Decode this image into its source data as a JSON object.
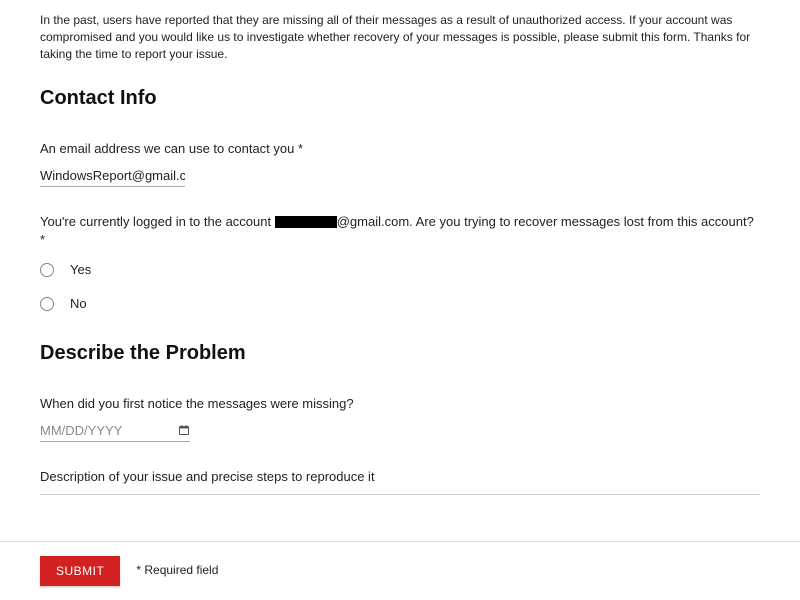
{
  "intro": "In the past, users have reported that they are missing all of their messages as a result of unauthorized access. If your account was compromised and you would like us to investigate whether recovery of your messages is possible, please submit this form. Thanks for taking the time to report your issue.",
  "sections": {
    "contact": {
      "heading": "Contact Info",
      "email_label": "An email address we can use to contact you *",
      "email_value": "WindowsReport@gmail.com",
      "logged_in_prefix": "You're currently logged in to the account ",
      "logged_in_domain": "@gmail.com",
      "logged_in_suffix": ". Are you trying to recover messages lost from this account? *",
      "radio_yes": "Yes",
      "radio_no": "No"
    },
    "problem": {
      "heading": "Describe the Problem",
      "date_label": "When did you first notice the messages were missing?",
      "date_placeholder": "MM/DD/YYYY",
      "desc_label": "Description of your issue and precise steps to reproduce it"
    }
  },
  "submit_label": "SUBMIT",
  "required_note": "* Required field"
}
